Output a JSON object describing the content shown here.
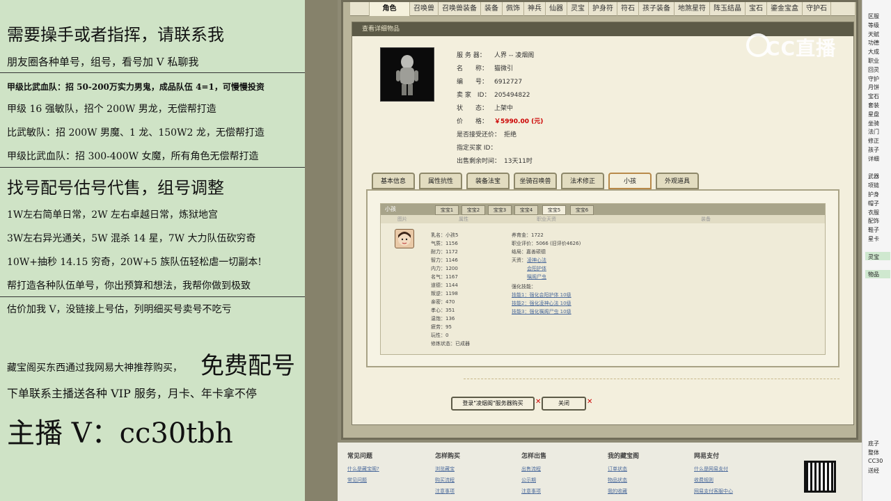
{
  "left": {
    "l1": "需要操手或者指挥，请联系我",
    "l2": "朋友圈各种单号，组号，看号加 V 私聊我",
    "l3": "甲级比武血队：招 50-200万实力男鬼，成品队伍 4=1，可慢慢投资",
    "l4": "甲级 16 强敏队，招个 200W 男龙，无偿帮打造",
    "l5": "比武敏队：招 200W 男魔、1 龙、150W2 龙，无偿帮打造",
    "l6": "甲级比武血队：招 300-400W 女魔，所有角色无偿帮打造",
    "l7": "找号配号估号代售，组号调整",
    "l8": "1W左右简单日常，2W 左右卓越日常，炼狱地宫",
    "l9": "3W左右异光通关，5W 混杀 14 星，7W 大力队伍砍穷奇",
    "l10": "10W+抽秒 14.15 穷奇，20W+5 族队伍轻松虐一切副本!",
    "l11": "帮打造各种队伍单号，你出预算和想法，我帮你做到极致",
    "l12": "估价加我 V，没链接上号估，列明细买号卖号不吃亏",
    "l13a": "藏宝阁买东西通过我网易大神推荐购买，",
    "l13b": "免费配号",
    "l14": "下单联系主播送各种 VIP 服务，月卡、年卡拿不停",
    "l15": "主播 V：cc30tbh"
  },
  "topnav": [
    "角色",
    "召唤兽",
    "召唤兽装备",
    "装备",
    "佩饰",
    "神兵",
    "仙器",
    "灵宝",
    "护身符",
    "符石",
    "孩子装备",
    "地煞星符",
    "阵玉结晶",
    "宝石",
    "鎏金宝盒",
    "守护石"
  ],
  "panel_title": "查看详细物品",
  "info": [
    {
      "k": "服 务 器：",
      "v": "人界 -- 凌烟阁"
    },
    {
      "k": "名　　称：",
      "v": "猫微引"
    },
    {
      "k": "编　　号：",
      "v": "6912727"
    },
    {
      "k": "卖 家　ID：",
      "v": "205494822"
    },
    {
      "k": "状　　态：",
      "v": "上架中"
    },
    {
      "k": "价　　格：",
      "v": "￥5990.00 (元)"
    },
    {
      "k": "是否接受还价：",
      "v": "拒绝"
    },
    {
      "k": "指定买家 ID：",
      "v": ""
    },
    {
      "k": "出售剩余时间：",
      "v": "13天11时"
    }
  ],
  "tabs2": [
    "基本信息",
    "属性抗性",
    "装备法宝",
    "坐骑召唤兽",
    "法术修正",
    "小孩",
    "外观道具"
  ],
  "inner_title": "小孩",
  "subtabs": [
    "宝宝1",
    "宝宝2",
    "宝宝3",
    "宝宝4",
    "宝宝5",
    "宝宝6"
  ],
  "colhead": [
    "图片",
    "属性",
    "职业天资",
    "装备"
  ],
  "child_stats": [
    {
      "k": "乳名：",
      "v": "小孩5"
    },
    {
      "k": "气质：",
      "v": "1156"
    },
    {
      "k": "耐力：",
      "v": "1172"
    },
    {
      "k": "智力：",
      "v": "1146"
    },
    {
      "k": "内力：",
      "v": "1200"
    },
    {
      "k": "名气：",
      "v": "1167"
    },
    {
      "k": "道德：",
      "v": "1144"
    },
    {
      "k": "叛逆：",
      "v": "1198"
    },
    {
      "k": "亲密：",
      "v": "470"
    },
    {
      "k": "孝心：",
      "v": "351"
    },
    {
      "k": "温饱：",
      "v": "136"
    },
    {
      "k": "疲劳：",
      "v": "95"
    },
    {
      "k": "玩性：",
      "v": "0"
    },
    {
      "k": "修炼状态：",
      "v": "已成器"
    }
  ],
  "child_right": {
    "nurture": "养育金：1722",
    "rating": "职业评价：5066 (旧评价4626)",
    "ending": "结局：嘉善硕德",
    "talent_label": "天资：",
    "talents": [
      "凌神心法",
      "会阳护体",
      "嘱阁尸虫"
    ],
    "skill_label": "强化技能：",
    "skills": [
      "技能1：强化会阳护体 10级",
      "技能2：强化凌神心法 10级",
      "技能3：强化嘱阁尸虫 10级"
    ]
  },
  "buttons": {
    "buy": "登录\"凌烟阁\"服务器购买",
    "close": "关闭"
  },
  "footer": [
    {
      "h": "常见问题",
      "l": [
        "什么是藏宝阁?",
        "常见问题"
      ]
    },
    {
      "h": "怎样购买",
      "l": [
        "浏览藏宝",
        "购买流程",
        "注意事项"
      ]
    },
    {
      "h": "怎样出售",
      "l": [
        "出售流程",
        "公示期",
        "注意事项"
      ]
    },
    {
      "h": "我的藏宝阁",
      "l": [
        "订单状态",
        "物品状态",
        "我的收藏"
      ]
    },
    {
      "h": "网易支付",
      "l": [
        "什么是网易支付",
        "收费规则",
        "网易支付客服中心"
      ]
    }
  ],
  "logo": "CC直播",
  "right_items": [
    "区服",
    "等级",
    "天赋",
    "功德",
    "大成",
    "职业",
    "回灵",
    "守护",
    "月饼",
    "宝石",
    "套装",
    "星盘",
    "坐骑",
    "法门",
    "修正",
    "孩子",
    "详细",
    "",
    "武器",
    "项链",
    "护身",
    "帽子",
    "衣服",
    "配饰",
    "鞋子",
    "星卡",
    "",
    "灵宝",
    "",
    "物品",
    "",
    "",
    "",
    "",
    "",
    "",
    "",
    "",
    "",
    "",
    "",
    "",
    "",
    "",
    "",
    "",
    "",
    "",
    "底子",
    "整体",
    "CC30",
    "送经"
  ]
}
